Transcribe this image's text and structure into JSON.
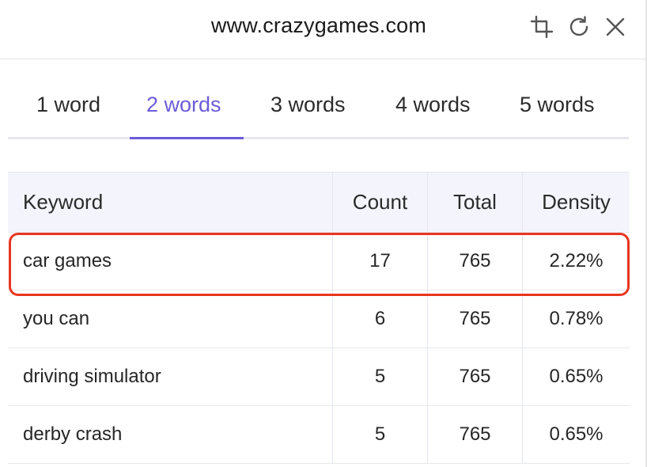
{
  "header": {
    "url": "www.crazygames.com",
    "icons": [
      "crop-icon",
      "refresh-icon",
      "close-icon"
    ]
  },
  "tabs": [
    {
      "label": "1 word",
      "active": false
    },
    {
      "label": "2 words",
      "active": true
    },
    {
      "label": "3 words",
      "active": false
    },
    {
      "label": "4 words",
      "active": false
    },
    {
      "label": "5 words",
      "active": false
    }
  ],
  "table": {
    "columns": [
      "Keyword",
      "Count",
      "Total",
      "Density"
    ],
    "rows": [
      {
        "keyword": "car games",
        "count": "17",
        "total": "765",
        "density": "2.22%",
        "highlighted": true
      },
      {
        "keyword": "you can",
        "count": "6",
        "total": "765",
        "density": "0.78%",
        "highlighted": false
      },
      {
        "keyword": "driving simulator",
        "count": "5",
        "total": "765",
        "density": "0.65%",
        "highlighted": false
      },
      {
        "keyword": "derby crash",
        "count": "5",
        "total": "765",
        "density": "0.65%",
        "highlighted": false
      }
    ]
  },
  "colors": {
    "accent": "#6a5cd8",
    "highlight_border": "#e8351f",
    "header_row_bg": "#f4f5fc"
  }
}
